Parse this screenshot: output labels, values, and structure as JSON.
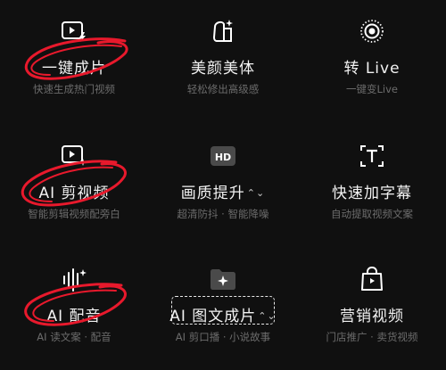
{
  "features": [
    {
      "label": "一键成片",
      "subtitle": "快速生成热门视频",
      "icon": "video-flash-icon"
    },
    {
      "label": "美颜美体",
      "subtitle": "轻松修出高级感",
      "icon": "face-sparkle-icon"
    },
    {
      "label": "转 Live",
      "subtitle": "一键变Live",
      "icon": "live-photo-icon"
    },
    {
      "label": "AI 剪视频",
      "subtitle": "智能剪辑视频配旁白",
      "icon": "ai-video-icon"
    },
    {
      "label": "画质提升",
      "subtitle": "超清防抖 · 智能降噪",
      "icon": "hd-icon"
    },
    {
      "label": "快速加字幕",
      "subtitle": "自动提取视频文案",
      "icon": "text-frame-icon"
    },
    {
      "label": "AI 配音",
      "subtitle": "AI 读文案 · 配音",
      "icon": "waveform-sparkle-icon"
    },
    {
      "label": "AI 图文成片",
      "subtitle": "AI 剪口播 · 小说故事",
      "icon": "folder-sparkle-icon"
    },
    {
      "label": "营销视频",
      "subtitle": "门店推广 · 卖货视频",
      "icon": "shopping-bag-icon"
    }
  ],
  "colors": {
    "background": "#101010",
    "annotation_red": "#e8192c",
    "label": "#f2f2f2",
    "subtitle": "#6c6c6c"
  }
}
